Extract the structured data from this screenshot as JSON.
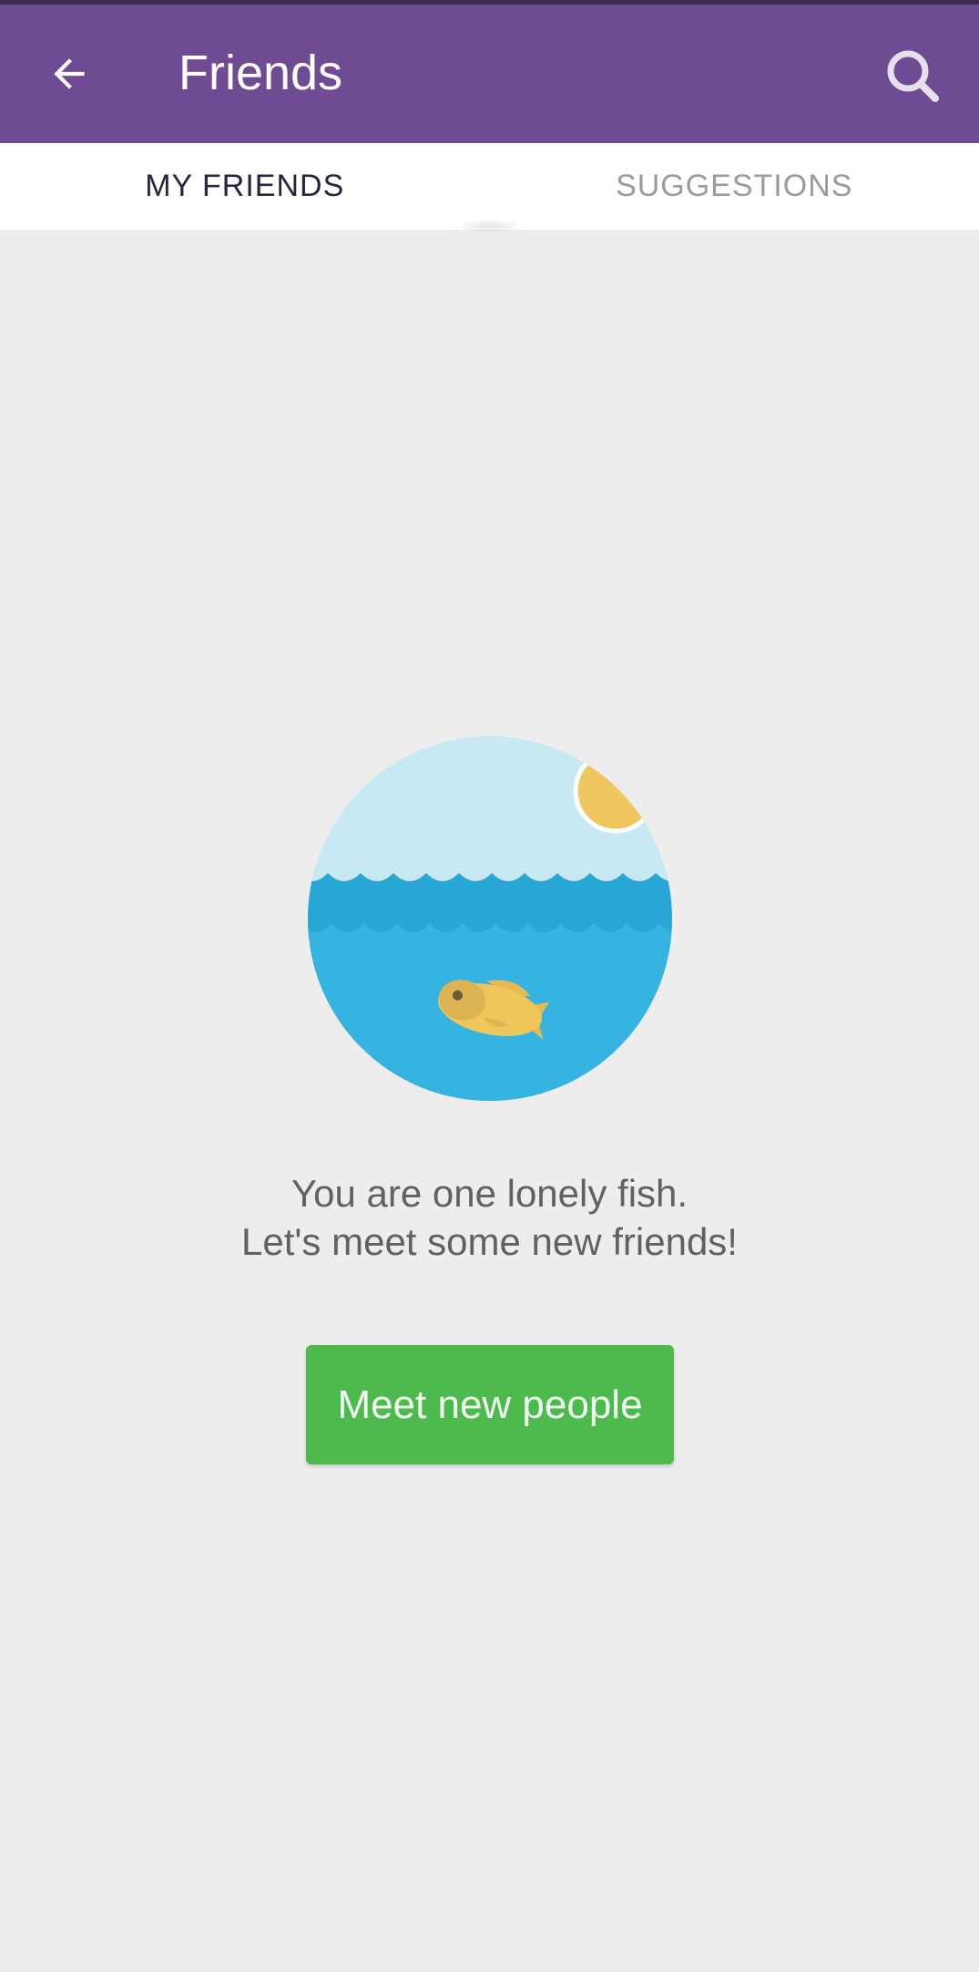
{
  "colors": {
    "app_bar": "#6e4b93",
    "background": "#ededed",
    "button": "#4cba4c",
    "sky": "#c8e8f4",
    "water_dark": "#28a6d6",
    "water": "#35b3e1",
    "sun": "#f0c75e",
    "fish": "#efc65a"
  },
  "header": {
    "back_icon": "arrow-left-icon",
    "title": "Friends",
    "search_icon": "search-icon"
  },
  "tabs": [
    {
      "label": "MY FRIENDS",
      "active": true
    },
    {
      "label": "SUGGESTIONS",
      "active": false
    }
  ],
  "empty_state": {
    "illustration": "lonely-fish-illustration",
    "line1": "You are one lonely fish.",
    "line2": "Let's meet some new friends!",
    "button_label": "Meet new people"
  }
}
